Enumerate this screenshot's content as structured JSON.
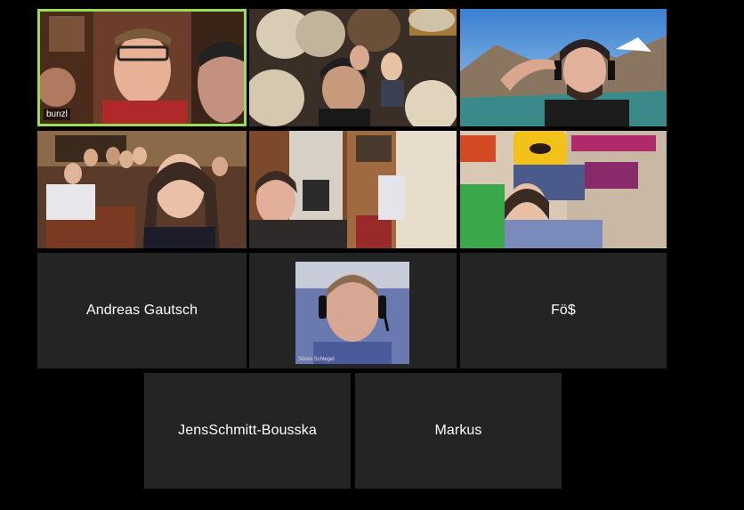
{
  "participants": [
    {
      "id": "p1",
      "label": "bunzl",
      "has_video": true,
      "active_speaker": true
    },
    {
      "id": "p2",
      "label": "",
      "has_video": true
    },
    {
      "id": "p3",
      "label": "",
      "has_video": true
    },
    {
      "id": "p4",
      "label": "",
      "has_video": true
    },
    {
      "id": "p5",
      "label": "",
      "has_video": true
    },
    {
      "id": "p6",
      "label": "",
      "has_video": true
    },
    {
      "id": "p7",
      "label": "Andreas Gautsch",
      "has_video": false
    },
    {
      "id": "p8",
      "label": "Sören Schlegel",
      "has_video": true
    },
    {
      "id": "p9",
      "label": "Fö$",
      "has_video": false
    },
    {
      "id": "p10",
      "label": "JensSchmitt-Bousska",
      "has_video": false
    },
    {
      "id": "p11",
      "label": "Markus",
      "has_video": false
    }
  ],
  "colors": {
    "background": "#000000",
    "tile": "#242424",
    "active_border": "#9ddc5a",
    "name_text": "#ffffff"
  }
}
